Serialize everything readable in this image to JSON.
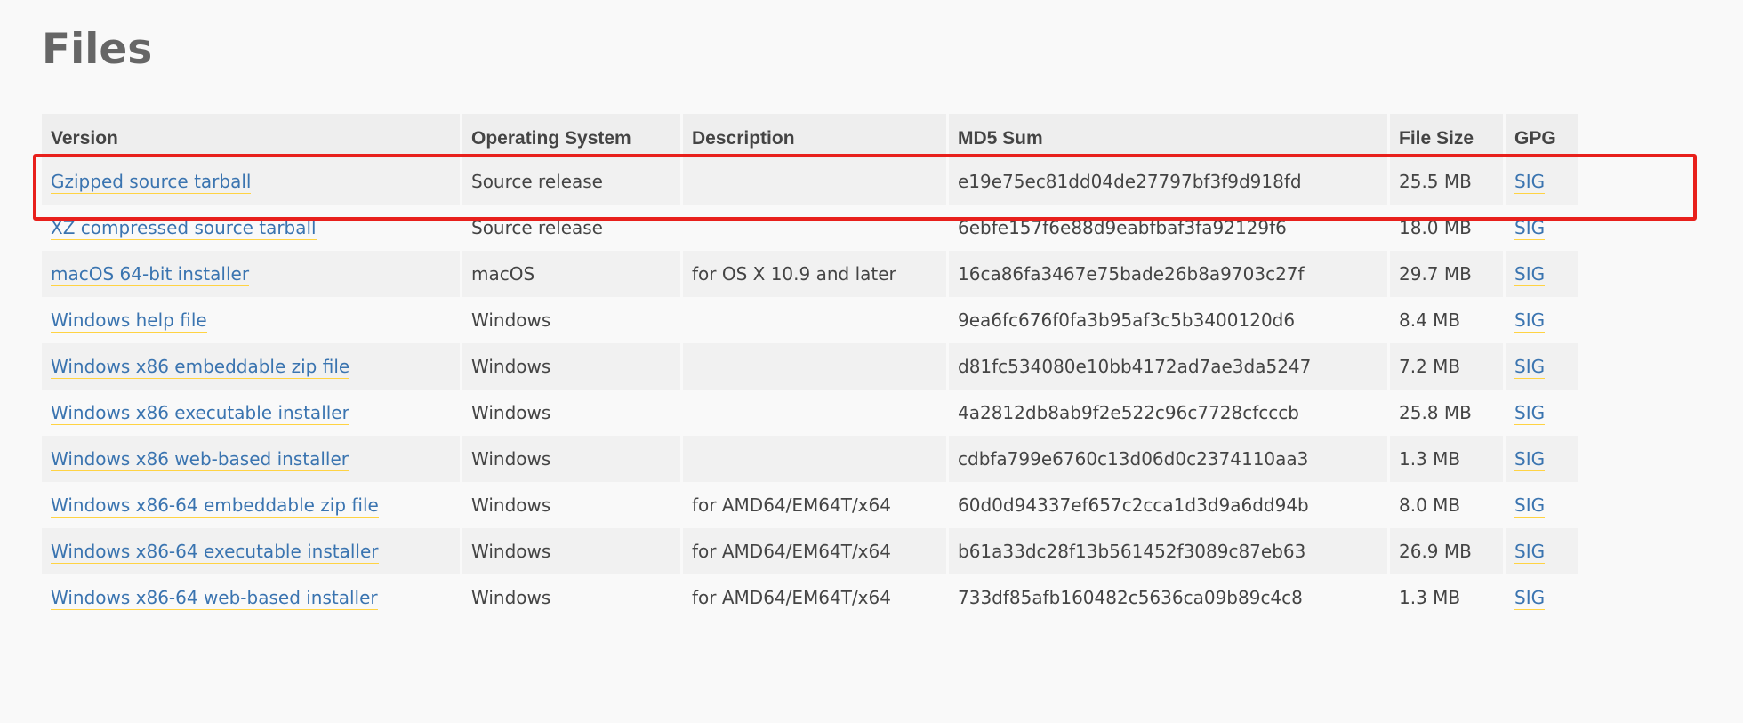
{
  "page": {
    "title": "Files"
  },
  "table": {
    "headers": {
      "version": "Version",
      "os": "Operating System",
      "description": "Description",
      "md5": "MD5 Sum",
      "size": "File Size",
      "gpg": "GPG"
    },
    "rows": [
      {
        "version": "Gzipped source tarball",
        "os": "Source release",
        "description": "",
        "md5": "e19e75ec81dd04de27797bf3f9d918fd",
        "size": "25.5 MB",
        "gpg": "SIG"
      },
      {
        "version": "XZ compressed source tarball",
        "os": "Source release",
        "description": "",
        "md5": "6ebfe157f6e88d9eabfbaf3fa92129f6",
        "size": "18.0 MB",
        "gpg": "SIG"
      },
      {
        "version": "macOS 64-bit installer",
        "os": "macOS",
        "description": "for OS X 10.9 and later",
        "md5": "16ca86fa3467e75bade26b8a9703c27f",
        "size": "29.7 MB",
        "gpg": "SIG"
      },
      {
        "version": "Windows help file",
        "os": "Windows",
        "description": "",
        "md5": "9ea6fc676f0fa3b95af3c5b3400120d6",
        "size": "8.4 MB",
        "gpg": "SIG"
      },
      {
        "version": "Windows x86 embeddable zip file",
        "os": "Windows",
        "description": "",
        "md5": "d81fc534080e10bb4172ad7ae3da5247",
        "size": "7.2 MB",
        "gpg": "SIG"
      },
      {
        "version": "Windows x86 executable installer",
        "os": "Windows",
        "description": "",
        "md5": "4a2812db8ab9f2e522c96c7728cfcccb",
        "size": "25.8 MB",
        "gpg": "SIG"
      },
      {
        "version": "Windows x86 web-based installer",
        "os": "Windows",
        "description": "",
        "md5": "cdbfa799e6760c13d06d0c2374110aa3",
        "size": "1.3 MB",
        "gpg": "SIG"
      },
      {
        "version": "Windows x86-64 embeddable zip file",
        "os": "Windows",
        "description": "for AMD64/EM64T/x64",
        "md5": "60d0d94337ef657c2cca1d3d9a6dd94b",
        "size": "8.0 MB",
        "gpg": "SIG"
      },
      {
        "version": "Windows x86-64 executable installer",
        "os": "Windows",
        "description": "for AMD64/EM64T/x64",
        "md5": "b61a33dc28f13b561452f3089c87eb63",
        "size": "26.9 MB",
        "gpg": "SIG"
      },
      {
        "version": "Windows x86-64 web-based installer",
        "os": "Windows",
        "description": "for AMD64/EM64T/x64",
        "md5": "733df85afb160482c5636ca09b89c4c8",
        "size": "1.3 MB",
        "gpg": "SIG"
      }
    ]
  },
  "colors": {
    "link": "#3a74b0",
    "link_underline": "#ffd343",
    "highlight": "#e8201c",
    "header_bg": "#eeeeee",
    "row_alt_bg": "#f1f1f1",
    "page_bg": "#f9f9f9"
  }
}
